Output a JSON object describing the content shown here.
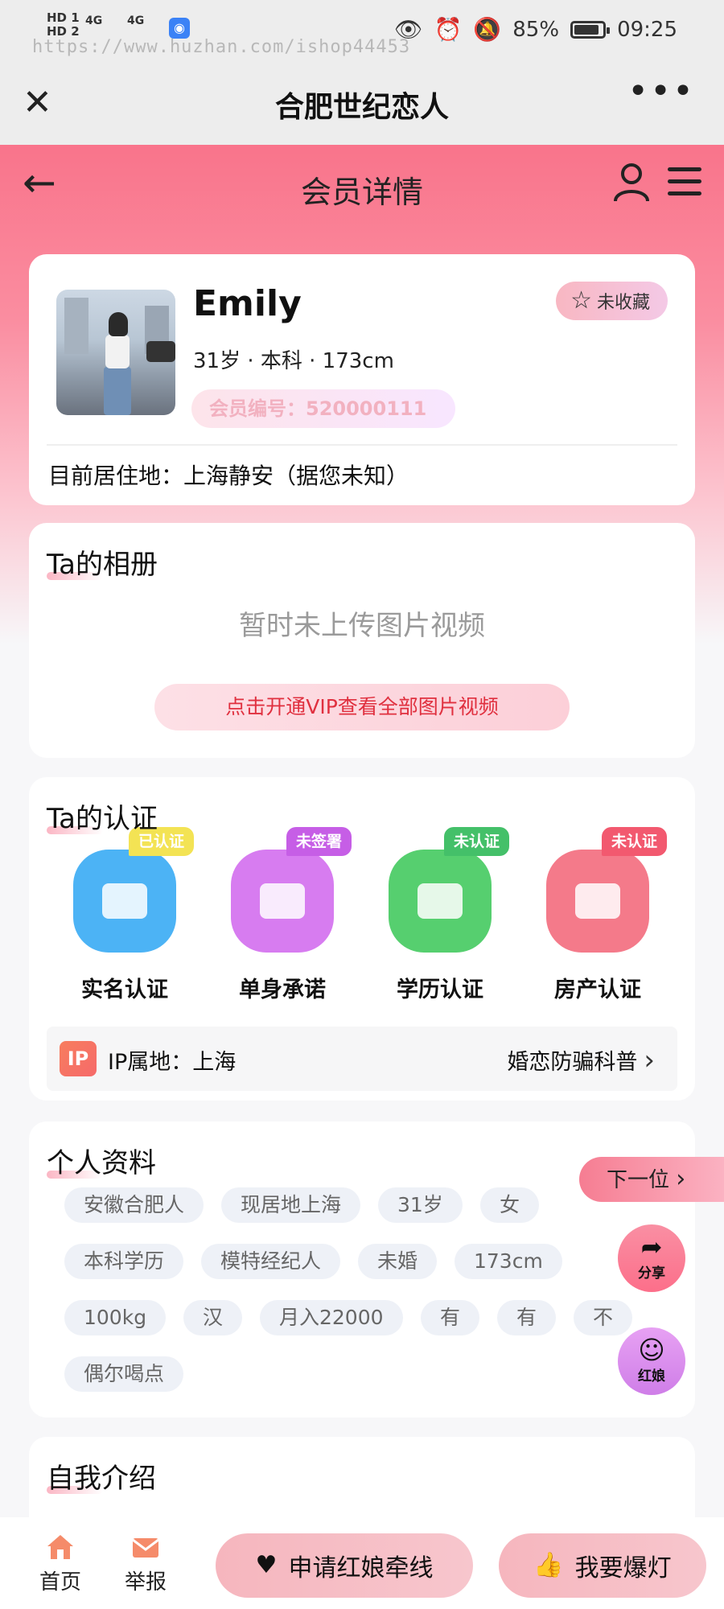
{
  "status_bar": {
    "sim1": "HD 1",
    "sim2": "HD 2",
    "network1": "4G",
    "network2": "4G",
    "watermark": "https://www.huzhan.com/ishop44453",
    "battery": "85%",
    "time": "09:25"
  },
  "browser": {
    "title": "合肥世纪恋人"
  },
  "nav": {
    "title": "会员详情"
  },
  "profile": {
    "name": "Emily",
    "basic_info": "31岁 · 本科 · 173cm",
    "member_no": "会员编号：520000111",
    "favorite_label": "未收藏",
    "residence": "目前居住地：上海静安（据您未知）"
  },
  "album": {
    "title": "Ta的相册",
    "empty_text": "暂时未上传图片视频",
    "vip_button": "点击开通VIP查看全部图片视频"
  },
  "certification": {
    "title": "Ta的认证",
    "items": [
      {
        "label": "实名认证",
        "tag": "已认证",
        "tag_color": "#f3e354",
        "icon_color": "#4cb3f5"
      },
      {
        "label": "单身承诺",
        "tag": "未签署",
        "tag_color": "#c65ee6",
        "icon_color": "#d77cf0"
      },
      {
        "label": "学历认证",
        "tag": "未认证",
        "tag_color": "#44c069",
        "icon_color": "#56cf6f"
      },
      {
        "label": "房产认证",
        "tag": "未认证",
        "tag_color": "#f2596f",
        "icon_color": "#f47a8a"
      }
    ],
    "ip_badge": "IP",
    "ip_text": "IP属地：上海",
    "fraud_link": "婚恋防骗科普"
  },
  "personal": {
    "title": "个人资料",
    "tags": [
      "安徽合肥人",
      "现居地上海",
      "31岁",
      "女",
      "本科学历",
      "模特经纪人",
      "未婚",
      "173cm",
      "100kg",
      "汉",
      "月入22000",
      "有",
      "有",
      "不",
      "偶尔喝点"
    ]
  },
  "intro": {
    "title": "自我介绍"
  },
  "floating": {
    "next": "下一位",
    "share": "分享",
    "matchmaker": "红娘"
  },
  "bottom_bar": {
    "home": "首页",
    "report": "举报",
    "apply_matchmaker": "申请红娘牵线",
    "hot": "我要爆灯"
  }
}
